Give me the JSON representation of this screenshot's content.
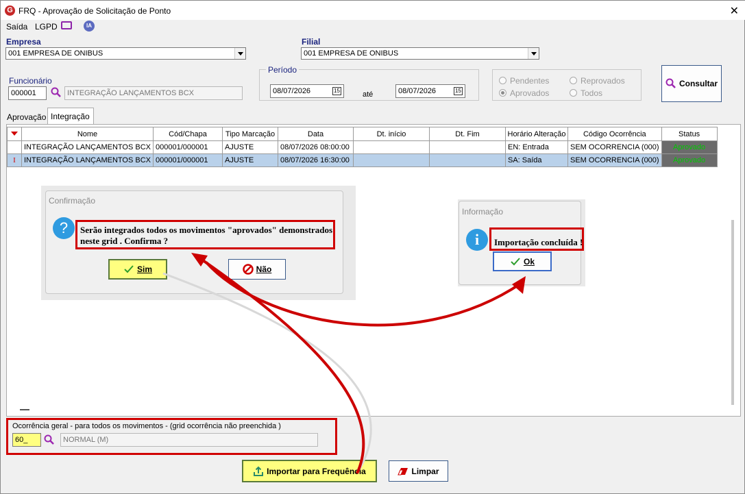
{
  "window": {
    "title": "FRQ - Aprovação de Solicitação de Ponto",
    "logo": "G"
  },
  "menu": {
    "saida": "Saída",
    "lgpd": "LGPD",
    "ia": "IA"
  },
  "empresa": {
    "label": "Empresa",
    "value": "001 EMPRESA DE ONIBUS"
  },
  "filial": {
    "label": "Filial",
    "value": "001 EMPRESA DE ONIBUS"
  },
  "funcionario": {
    "label": "Funcionário",
    "code": "000001",
    "name": "INTEGRAÇÃO LANÇAMENTOS BCX"
  },
  "periodo": {
    "label": "Período",
    "start": "08/07/2026",
    "separator": "até",
    "end": "08/07/2026",
    "cal": "15"
  },
  "status_filter": {
    "pendentes": "Pendentes",
    "reprovados": "Reprovados",
    "aprovados": "Aprovados",
    "todos": "Todos"
  },
  "consultar_label": "Consultar",
  "tabs": [
    "Aprovação",
    "Integração"
  ],
  "grid": {
    "columns": [
      "Nome",
      "Cód/Chapa",
      "Tipo Marcação",
      "Data",
      "Dt. início",
      "Dt. Fim",
      "Horário Alteração",
      "Código Ocorrência",
      "Status"
    ],
    "rows": [
      [
        "INTEGRAÇÃO LANÇAMENTOS BCX",
        "000001/000001",
        "AJUSTE",
        "08/07/2026 08:00:00",
        "",
        "",
        "EN: Entrada",
        "SEM OCORRENCIA (000)",
        "Aprovado"
      ],
      [
        "INTEGRAÇÃO LANÇAMENTOS BCX",
        "000001/000001",
        "AJUSTE",
        "08/07/2026 16:30:00",
        "",
        "",
        "SA: Saída",
        "SEM OCORRENCIA (000)",
        "Aprovado"
      ]
    ],
    "cursor": "I"
  },
  "confirm_dialog": {
    "title": "Confirmação",
    "message_line1": "Serão integrados todos os movimentos \"aprovados\" demonstrados",
    "message_line2": "neste grid . Confirma ?",
    "yes": "Sim",
    "no": "Não"
  },
  "info_dialog": {
    "title": "Informação",
    "message": "Importação concluída !",
    "ok": "Ok"
  },
  "ocorrencia": {
    "label": "Ocorrência geral - para todos os movimentos - (grid ocorrência  não preenchida )",
    "code": "60_",
    "description": "NORMAL (M)"
  },
  "importar_label": "Importar para Frequência",
  "limpar_label": "Limpar",
  "colors": {
    "accent_red": "#d00000",
    "status_green": "#00c800",
    "highlight_yellow": "#ffff80"
  }
}
